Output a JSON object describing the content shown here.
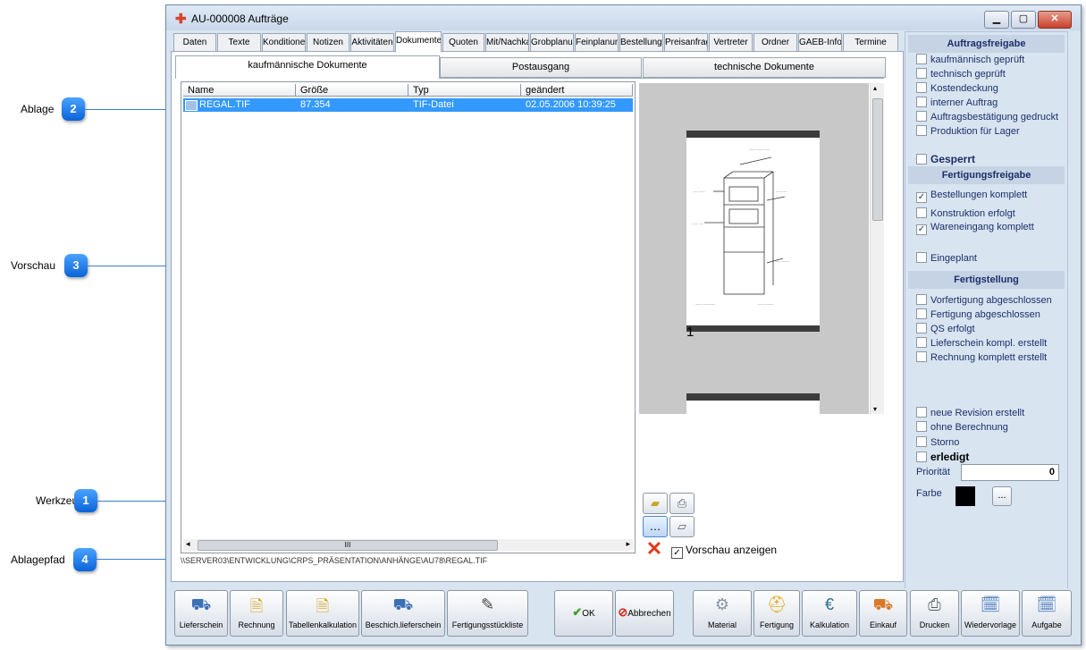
{
  "window": {
    "title": "AU-000008 Aufträge",
    "min": "▁",
    "max": "▢",
    "close": "✕"
  },
  "callouts": [
    {
      "label": "Ablage",
      "num": "2"
    },
    {
      "label": "Vorschau",
      "num": "3"
    },
    {
      "label": "Werkzeuge",
      "num": "1"
    },
    {
      "label": "Ablagepfad",
      "num": "4"
    }
  ],
  "tabs": [
    "Daten",
    "Texte",
    "Konditionen",
    "Notizen",
    "Aktivitäten",
    "Dokumente",
    "Quoten",
    "Mit/Nachkalk",
    "Grobplanung",
    "Feinplanung",
    "Bestellungen",
    "Preisanfrage",
    "Vertreter",
    "Ordner",
    "GAEB-Info",
    "Termine"
  ],
  "subtabs": [
    "kaufmännische Dokumente",
    "Postausgang",
    "technische Dokumente"
  ],
  "filelist": {
    "columns": [
      "Name",
      "Größe",
      "Typ",
      "geändert"
    ],
    "rows": [
      {
        "name": "REGAL.TIF",
        "size": "87.354",
        "type": "TIF-Datei",
        "modified": "02.05.2006 10:39:25"
      }
    ],
    "scroll_mark": "III"
  },
  "preview": {
    "page_number": "1"
  },
  "show_preview": {
    "label": "Vorschau anzeigen",
    "checked": true
  },
  "path": "\\\\SERVER03\\ENTWICKLUNG\\CRPS_PRÄSENTATION\\ANHÄNGE\\AU78\\REGAL.TIF",
  "right": {
    "auftragsfreigabe": {
      "title": "Auftragsfreigabe",
      "items": [
        {
          "label": "kaufmännisch geprüft",
          "checked": false
        },
        {
          "label": "technisch geprüft",
          "checked": false
        },
        {
          "label": "Kostendeckung",
          "checked": false
        },
        {
          "label": "interner Auftrag",
          "checked": false
        },
        {
          "label": "Auftragsbestätigung gedruckt",
          "checked": false
        },
        {
          "label": "Produktion für Lager",
          "checked": false
        }
      ]
    },
    "gesperrt": "Gesperrt",
    "fertigungsfreigabe": {
      "title": "Fertigungsfreigabe",
      "items": [
        {
          "label": "Bestellungen komplett",
          "checked": true
        },
        {
          "label": "Konstruktion erfolgt",
          "checked": false
        },
        {
          "label": "Wareneingang komplett",
          "checked": true
        }
      ]
    },
    "eingeplant": "Eingeplant",
    "fertigstellung": {
      "title": "Fertigstellung",
      "items": [
        {
          "label": "Vorfertigung abgeschlossen",
          "checked": false
        },
        {
          "label": "Fertigung abgeschlossen",
          "checked": false
        },
        {
          "label": "QS erfolgt",
          "checked": false
        },
        {
          "label": "Lieferschein kompl. erstellt",
          "checked": false
        },
        {
          "label": "Rechnung komplett erstellt",
          "checked": false
        }
      ]
    },
    "extra": [
      {
        "label": "neue Revision erstellt",
        "checked": false
      },
      {
        "label": "ohne Berechnung",
        "checked": false
      },
      {
        "label": "Storno",
        "checked": false
      }
    ],
    "erledigt": "erledigt",
    "prioritaet_label": "Priorität",
    "prioritaet_value": "0",
    "farbe_label": "Farbe",
    "farbe_value": "#000000",
    "farbe_button": "..."
  },
  "toolbar_buttons": {
    "ok": "OK",
    "cancel": "Abbrechen",
    "items": [
      "Lieferschein",
      "Rechnung",
      "Tabellenkalkulation",
      "Beschich.lieferschein",
      "Fertigungsstückliste",
      "Material",
      "Fertigung",
      "Kalkulation",
      "Einkauf",
      "Drucken",
      "Wiedervorlage",
      "Aufgabe"
    ]
  },
  "tool_icons": [
    "open-folder-icon",
    "print-icon",
    "browse-icon",
    "scanner-icon",
    "delete-icon"
  ]
}
